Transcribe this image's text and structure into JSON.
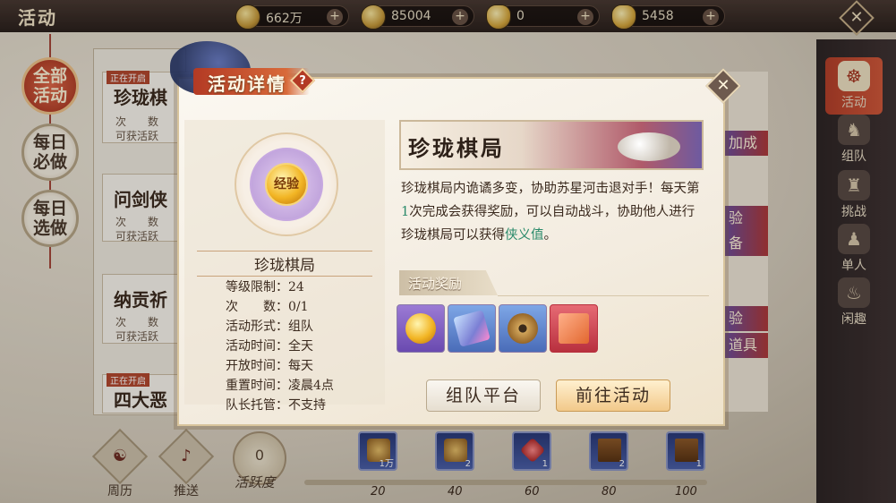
{
  "header": {
    "title": "活动",
    "resources": [
      {
        "name": "silver-coin-icon",
        "value": "662万"
      },
      {
        "name": "gold-ingot-icon",
        "value": "85004"
      },
      {
        "name": "yuanbao-icon",
        "value": "0"
      },
      {
        "name": "bound-ingot-icon",
        "value": "5458"
      }
    ],
    "plus": "+"
  },
  "left_tabs": [
    {
      "label": "全部\n活动",
      "active": true
    },
    {
      "label": "每日\n必做",
      "active": false
    },
    {
      "label": "每日\n选做",
      "active": false
    }
  ],
  "list_cards": [
    {
      "tag": "正在开启",
      "name": "珍珑棋",
      "rows": [
        "次　　数",
        "可获活跃"
      ]
    },
    {
      "tag": "",
      "name": "问剑侠",
      "rows": [
        "次　　数",
        "可获活跃"
      ]
    },
    {
      "tag": "",
      "name": "纳贡祈",
      "rows": [
        "次　　数",
        "可获活跃"
      ]
    },
    {
      "tag": "正在开启",
      "name": "四大恶",
      "rows": []
    }
  ],
  "right_strips": [
    "加成",
    "验",
    "备",
    "验",
    "道具"
  ],
  "right_menu": [
    {
      "label": "活动",
      "icon": "activity-icon",
      "active": true
    },
    {
      "label": "组队",
      "icon": "team-icon",
      "active": false
    },
    {
      "label": "挑战",
      "icon": "challenge-icon",
      "active": false
    },
    {
      "label": "单人",
      "icon": "solo-icon",
      "active": false
    },
    {
      "label": "闲趣",
      "icon": "leisure-icon",
      "active": false
    }
  ],
  "bottom": {
    "buttons": [
      {
        "label": "周历",
        "icon": "calendar-icon"
      },
      {
        "label": "推送",
        "icon": "bell-icon"
      }
    ],
    "activity_value": "0",
    "activity_label": "活跃度",
    "progress": 0,
    "milestones": [
      {
        "value": "20",
        "qty": "1万"
      },
      {
        "value": "40",
        "qty": "2"
      },
      {
        "value": "60",
        "qty": "1"
      },
      {
        "value": "80",
        "qty": "2"
      },
      {
        "value": "100",
        "qty": "1"
      }
    ]
  },
  "modal": {
    "title": "活动详情",
    "help": "?",
    "close": "✕",
    "medal_text": "经验",
    "activity_name": "珍珑棋局",
    "info": [
      "等级限制：24",
      "次　　数：0/1",
      "活动形式：组队",
      "活动时间：全天",
      "开放时间：每天",
      "重置时间：凌晨4点",
      "队长托管：不支持"
    ],
    "banner_title": "珍珑棋局",
    "desc_part1": "珍珑棋局内诡谲多变，协助苏星河击退对手！每天第",
    "desc_num": "1",
    "desc_part2": "次完成会获得奖励，可以自动战斗，协助他人进行珍珑棋局可以获得",
    "desc_hl": "侠义值",
    "desc_end": "。",
    "reward_title": "活动奖励",
    "rewards": [
      "exp-medal-icon",
      "skill-book-icon",
      "copper-coin-icon",
      "red-scroll-icon"
    ],
    "btn_team": "组队平台",
    "btn_go": "前往活动"
  }
}
